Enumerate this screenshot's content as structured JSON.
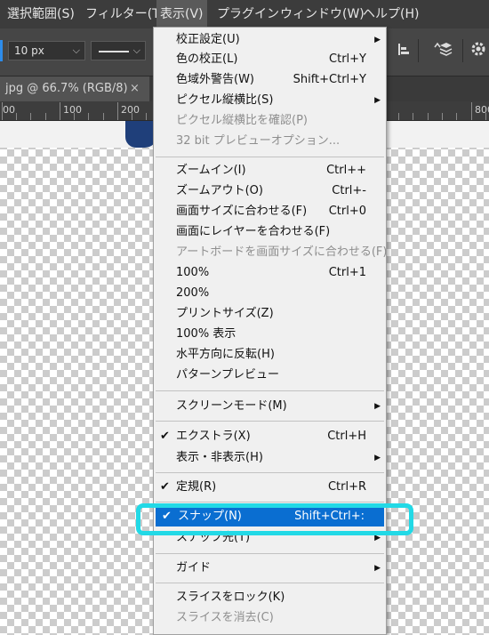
{
  "menubar": {
    "items": [
      {
        "label": "選択範囲(S)"
      },
      {
        "label": "フィルター(T)"
      },
      {
        "label": "表示(V)"
      },
      {
        "label": "プラグイン"
      },
      {
        "label": "ウィンドウ(W)"
      },
      {
        "label": "ヘルプ(H)"
      }
    ],
    "active_index": 2
  },
  "options_bar": {
    "stroke_width": "10 px",
    "chevron": "⌵",
    "stroke_style": "solid-line"
  },
  "doc_tab": {
    "title": "jpg @ 66.7% (RGB/8)",
    "close": "×"
  },
  "ruler": {
    "labels": [
      "00",
      "100",
      "200",
      "800"
    ]
  },
  "view_menu": {
    "items": [
      {
        "label": "校正設定(U)",
        "submenu": true
      },
      {
        "label": "色の校正(L)",
        "shortcut": "Ctrl+Y"
      },
      {
        "label": "色域外警告(W)",
        "shortcut": "Shift+Ctrl+Y"
      },
      {
        "label": "ピクセル縦横比(S)",
        "submenu": true
      },
      {
        "label": "ピクセル縦横比を確認(P)",
        "disabled": true
      },
      {
        "label": "32 bit プレビューオプション...",
        "disabled": true
      },
      {
        "label": "ズームイン(I)",
        "shortcut": "Ctrl++"
      },
      {
        "label": "ズームアウト(O)",
        "shortcut": "Ctrl+-"
      },
      {
        "label": "画面サイズに合わせる(F)",
        "shortcut": "Ctrl+0"
      },
      {
        "label": "画面にレイヤーを合わせる(F)"
      },
      {
        "label": "アートボードを画面サイズに合わせる(F)",
        "disabled": true
      },
      {
        "label": "100%",
        "shortcut": "Ctrl+1"
      },
      {
        "label": "200%"
      },
      {
        "label": "プリントサイズ(Z)"
      },
      {
        "label": "100% 表示"
      },
      {
        "label": "水平方向に反転(H)"
      },
      {
        "label": "パターンプレビュー"
      },
      {
        "label": "スクリーンモード(M)",
        "submenu": true
      },
      {
        "label": "エクストラ(X)",
        "shortcut": "Ctrl+H",
        "checked": true
      },
      {
        "label": "表示・非表示(H)",
        "submenu": true
      },
      {
        "label": "定規(R)",
        "shortcut": "Ctrl+R",
        "checked": true
      },
      {
        "label": "スナップ(N)",
        "shortcut": "Shift+Ctrl+:",
        "checked": true,
        "selected": true
      },
      {
        "label": "スナップ先(T)",
        "submenu": true
      },
      {
        "label": "ガイド",
        "submenu": true
      },
      {
        "label": "スライスをロック(K)"
      },
      {
        "label": "スライスを消去(C)",
        "disabled": true
      }
    ],
    "check_glyph": "✔",
    "submenu_glyph": "▶"
  },
  "colors": {
    "selection": "#0a6ed1",
    "callout": "#22d9e6",
    "menubar_bg": "#3c3c3c"
  }
}
